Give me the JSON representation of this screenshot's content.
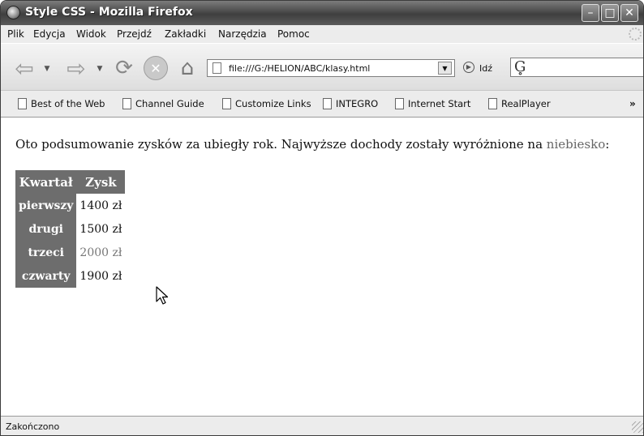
{
  "window": {
    "title": "Style CSS - Mozilla Firefox"
  },
  "menu": {
    "items": [
      "Plik",
      "Edycja",
      "Widok",
      "Przejdź",
      "Zakładki",
      "Narzędzia",
      "Pomoc"
    ]
  },
  "nav": {
    "url": "file:///G:/HELION/ABC/klasy.html",
    "go_label": "Idź",
    "search_engine_icon": "google-g-icon"
  },
  "bookmarks": {
    "items": [
      "Best of the Web",
      "Channel Guide",
      "Customize Links",
      "INTEGRO",
      "Internet Start",
      "RealPlayer"
    ],
    "more": "»"
  },
  "content": {
    "intro_prefix": "Oto podsumowanie zysków za ubiegły rok. Najwyższe dochody zostały wyróżnione na ",
    "intro_highlight": "niebiesko",
    "intro_suffix": ":",
    "table": {
      "headers": [
        "Kwartał",
        "Zysk"
      ],
      "rows": [
        {
          "quarter": "pierwszy",
          "profit": "1400 zł"
        },
        {
          "quarter": "drugi",
          "profit": "1500 zł"
        },
        {
          "quarter": "trzeci",
          "profit": "2000 zł"
        },
        {
          "quarter": "czwarty",
          "profit": "1900 zł"
        }
      ]
    }
  },
  "status": {
    "text": "Zakończono"
  },
  "colors": {
    "highlight": "#666666",
    "header_bg": "#6d6d6d"
  }
}
